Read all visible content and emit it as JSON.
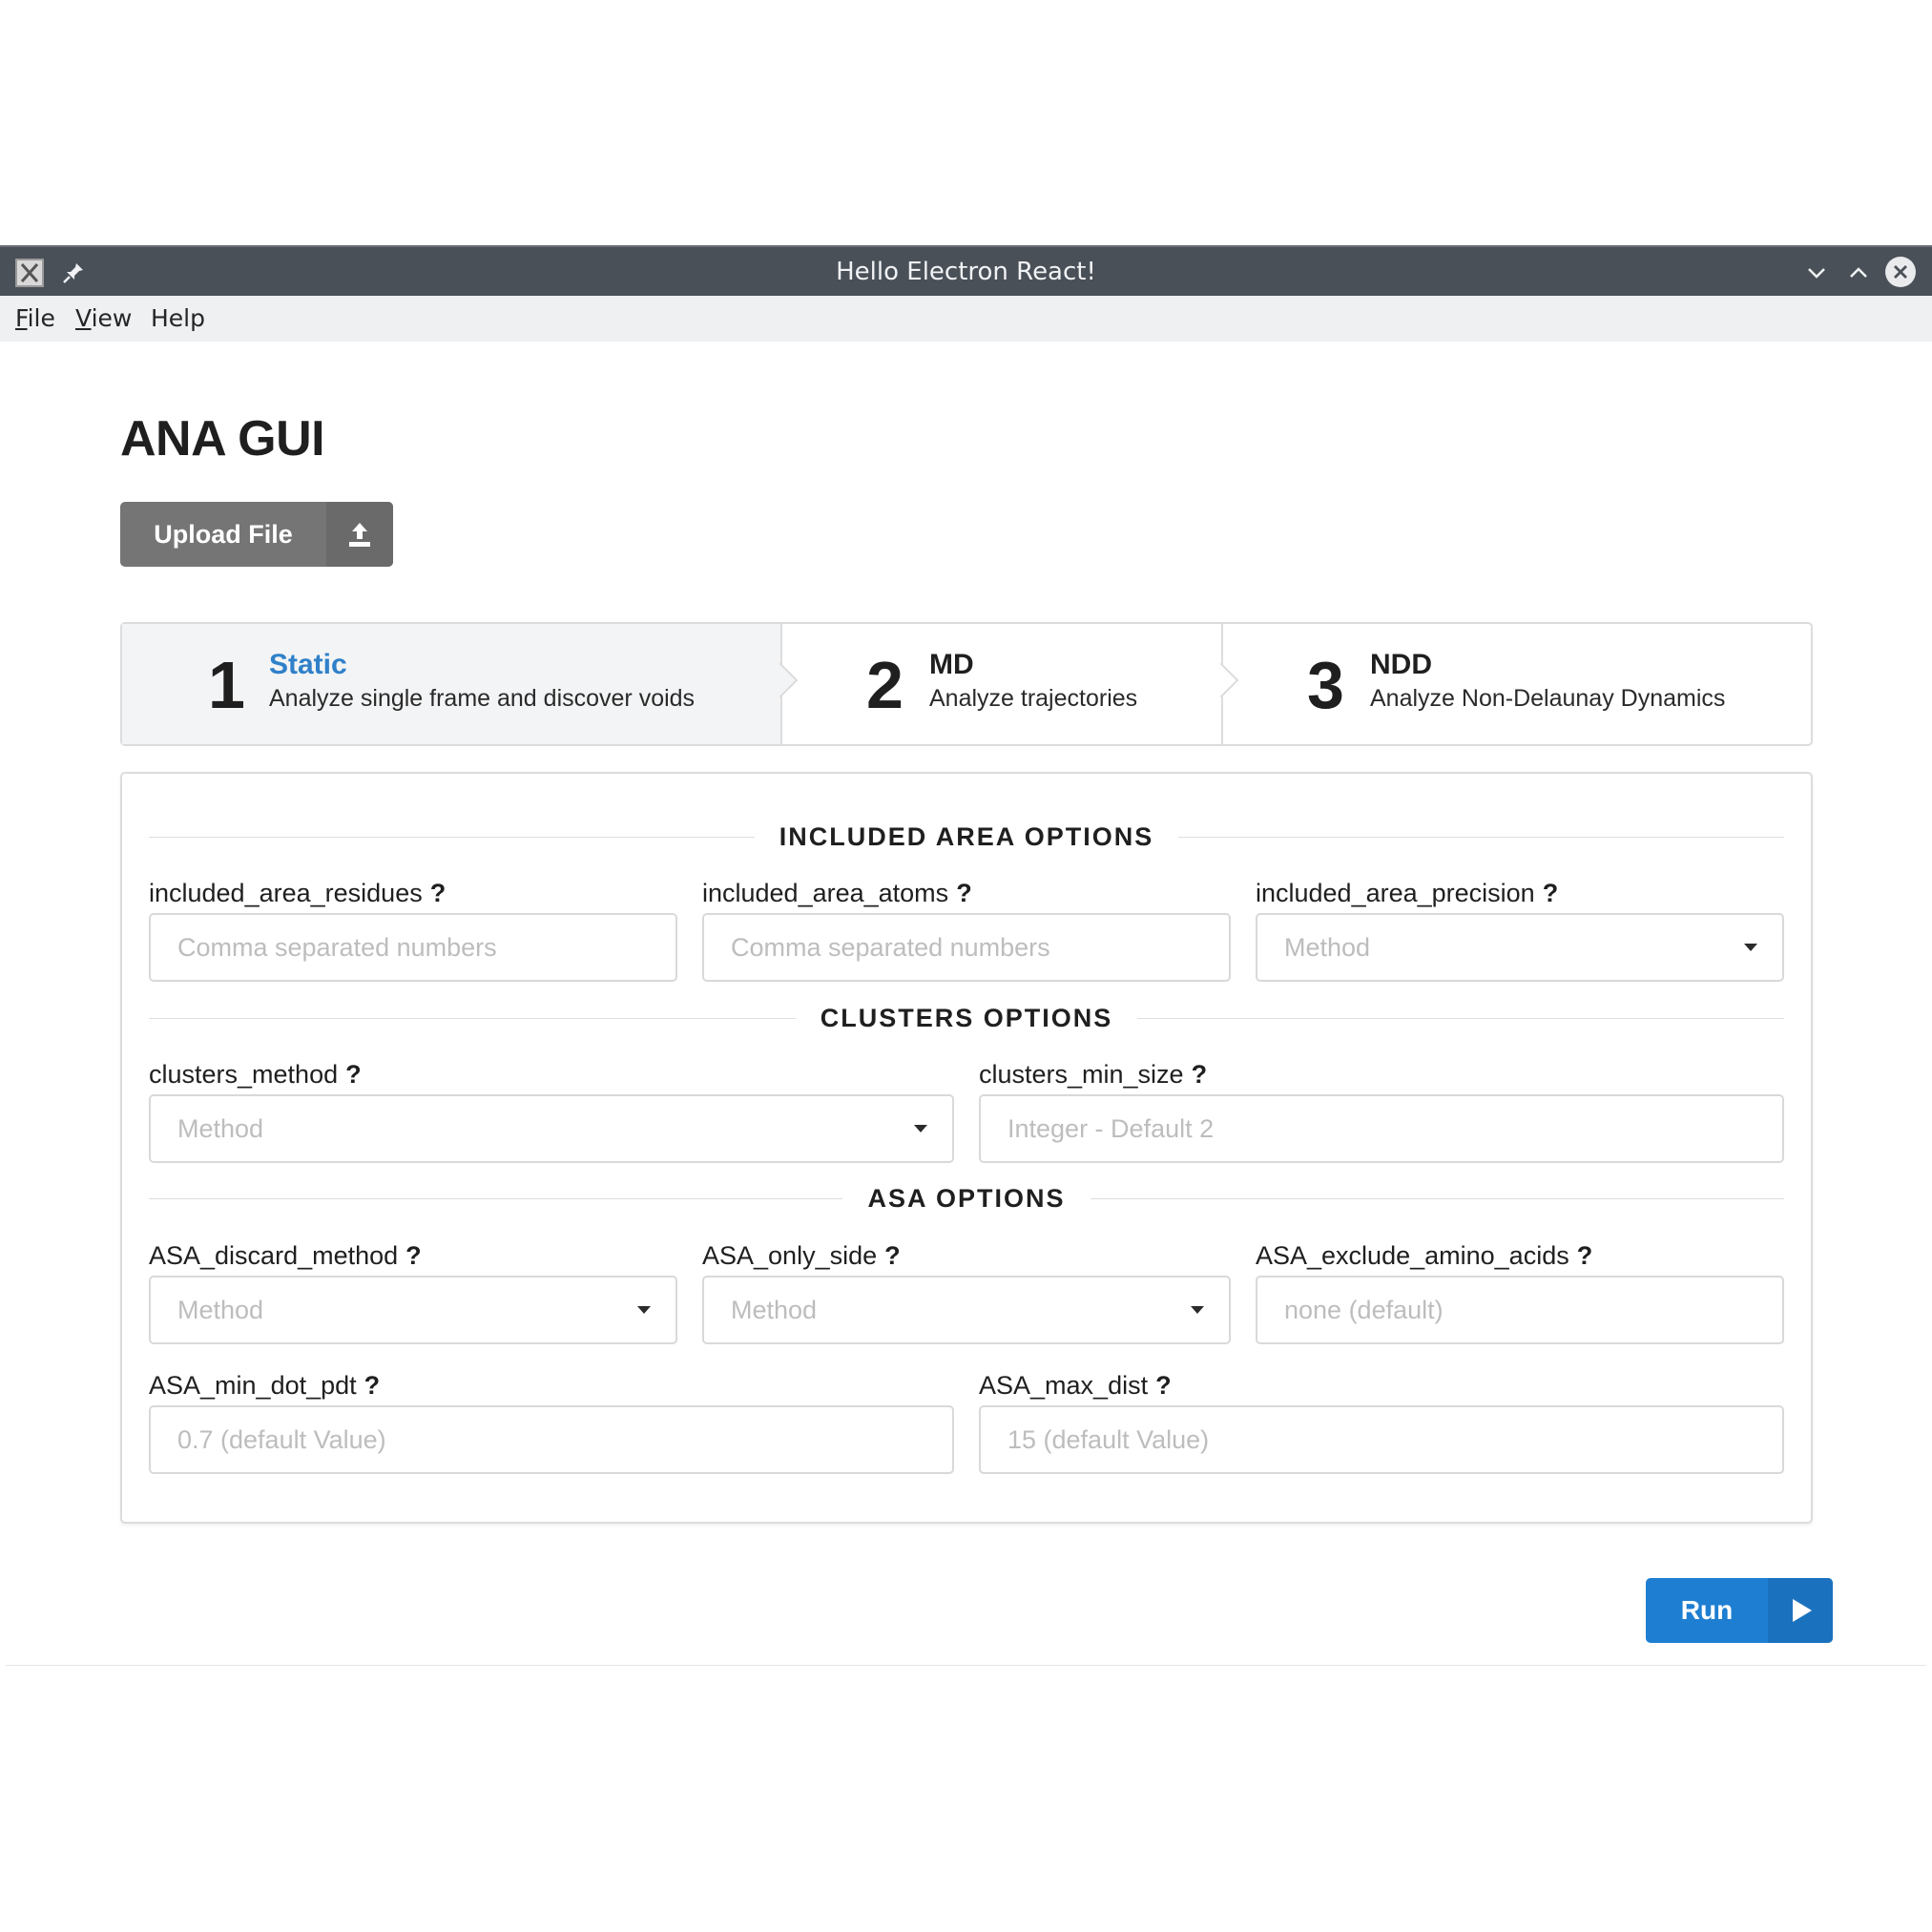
{
  "window": {
    "title": "Hello Electron React!"
  },
  "menubar": {
    "items": [
      {
        "first": "F",
        "rest": "ile"
      },
      {
        "first": "V",
        "rest": "iew"
      },
      {
        "first": "",
        "rest": "Help"
      }
    ]
  },
  "app": {
    "title": "ANA GUI",
    "upload_label": "Upload File",
    "run_label": "Run"
  },
  "steps": [
    {
      "number": "1",
      "title": "Static",
      "description": "Analyze single frame and discover voids",
      "active": true
    },
    {
      "number": "2",
      "title": "MD",
      "description": "Analyze trajectories",
      "active": false
    },
    {
      "number": "3",
      "title": "NDD",
      "description": "Analyze Non-Delaunay Dynamics",
      "active": false
    }
  ],
  "sections": {
    "included_area": {
      "heading": "INCLUDED AREA OPTIONS",
      "fields": [
        {
          "label": "included_area_residues",
          "placeholder": "Comma separated numbers"
        },
        {
          "label": "included_area_atoms",
          "placeholder": "Comma separated numbers"
        },
        {
          "label": "included_area_precision",
          "placeholder": "Method"
        }
      ]
    },
    "clusters": {
      "heading": "CLUSTERS OPTIONS",
      "fields": [
        {
          "label": "clusters_method",
          "placeholder": "Method"
        },
        {
          "label": "clusters_min_size",
          "placeholder": "Integer - Default 2"
        }
      ]
    },
    "asa": {
      "heading": "ASA OPTIONS",
      "fields": [
        {
          "label": "ASA_discard_method",
          "placeholder": "Method"
        },
        {
          "label": "ASA_only_side",
          "placeholder": "Method"
        },
        {
          "label": "ASA_exclude_amino_acids",
          "placeholder": "none (default)"
        },
        {
          "label": "ASA_min_dot_pdt",
          "placeholder": "0.7 (default Value)"
        },
        {
          "label": "ASA_max_dist",
          "placeholder": "15 (default Value)"
        }
      ]
    }
  },
  "help_glyph": "?",
  "colors": {
    "titlebar": "#4a5058",
    "accent_blue": "#1e7fd2",
    "active_step_title": "#2f80c9",
    "upload_button": "#757575"
  },
  "icons": {
    "app": "x-app-icon",
    "pin": "pin-icon",
    "minimize": "chevron-down-icon",
    "maximize": "chevron-up-icon",
    "close": "close-icon",
    "upload": "upload-icon",
    "run": "play-icon",
    "dropdown": "caret-down-icon"
  }
}
